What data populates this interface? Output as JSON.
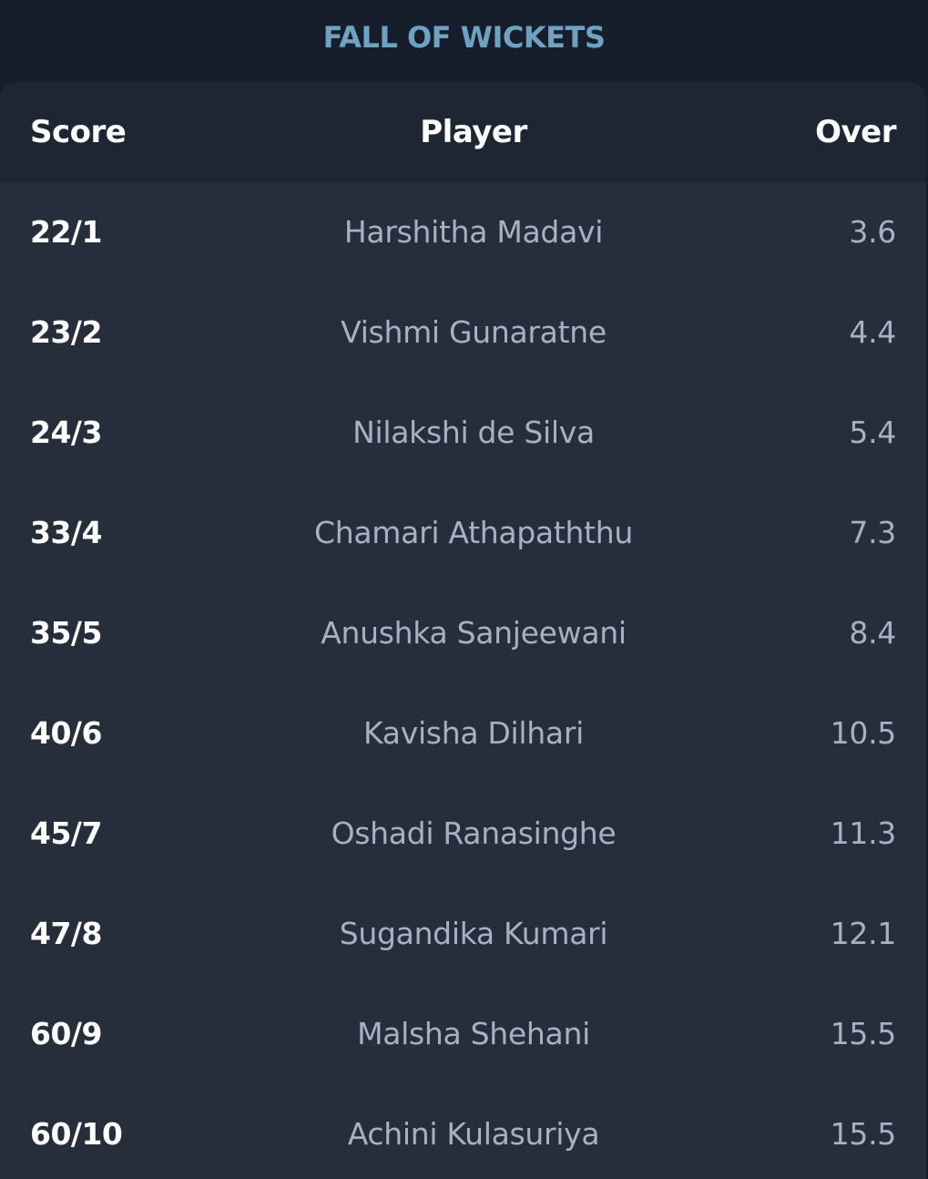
{
  "title": "FALL OF WICKETS",
  "columns": {
    "score": "Score",
    "player": "Player",
    "over": "Over"
  },
  "rows": [
    {
      "score": "22/1",
      "player": "Harshitha Madavi",
      "over": "3.6"
    },
    {
      "score": "23/2",
      "player": "Vishmi Gunaratne",
      "over": "4.4"
    },
    {
      "score": "24/3",
      "player": "Nilakshi de Silva",
      "over": "5.4"
    },
    {
      "score": "33/4",
      "player": "Chamari Athapaththu",
      "over": "7.3"
    },
    {
      "score": "35/5",
      "player": "Anushka Sanjeewani",
      "over": "8.4"
    },
    {
      "score": "40/6",
      "player": "Kavisha Dilhari",
      "over": "10.5"
    },
    {
      "score": "45/7",
      "player": "Oshadi Ranasinghe",
      "over": "11.3"
    },
    {
      "score": "47/8",
      "player": "Sugandika Kumari",
      "over": "12.1"
    },
    {
      "score": "60/9",
      "player": "Malsha Shehani",
      "over": "15.5"
    },
    {
      "score": "60/10",
      "player": "Achini Kulasuriya",
      "over": "15.5"
    }
  ],
  "colors": {
    "background": "#161e2b",
    "card": "#262e3b",
    "header_row": "#1f2633",
    "title_accent": "#6fa1c1",
    "primary_text": "#ffffff",
    "secondary_text": "#a6b1c4"
  }
}
